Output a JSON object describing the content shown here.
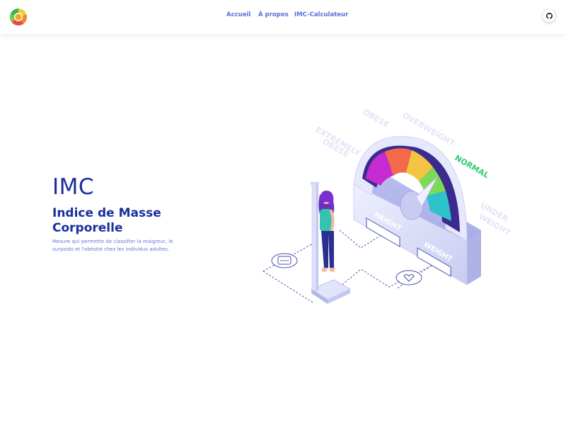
{
  "nav": {
    "links": [
      {
        "label": "Accueil"
      },
      {
        "label": "À propos"
      },
      {
        "label": "IMC-Calculateur"
      }
    ]
  },
  "hero": {
    "title": "IMC",
    "subtitle": "Indice de Masse Corporelle",
    "description": "Mesure qui permette de classifier la maigreur, le surpoids et l'obésité chez les individus adultes."
  },
  "illustration": {
    "gauge_labels": {
      "extremely_obese_1": "EXTREMELY",
      "extremely_obese_2": "OBESE",
      "obese": "OBESE",
      "overweight": "OVERWEIGHT",
      "normal": "NORMAL",
      "under": "UNDER",
      "weight": "WEIGHT"
    },
    "fields": {
      "height": "HEIGHT",
      "weight": "WEIGHT"
    }
  },
  "colors": {
    "brand": "#1a2f9c",
    "nav_link": "#5b6fd6",
    "gauge_normal": "#2ecc71",
    "device": "#d9dbf5"
  },
  "icons": {
    "logo": "bmi-logo",
    "github": "github-icon"
  }
}
